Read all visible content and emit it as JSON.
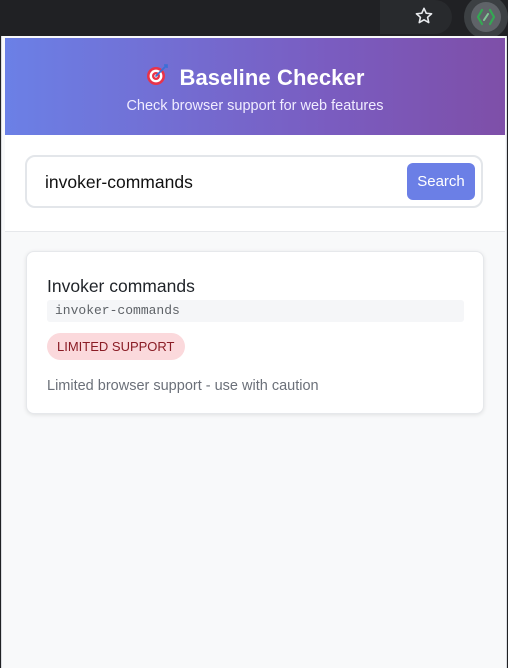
{
  "toolbar": {
    "star_icon": "star-outline-icon",
    "extension_icon": "baseline-extension-icon",
    "colors": {
      "extension_green": "#34a853"
    }
  },
  "header": {
    "icon": "dart-target-icon",
    "title": "Baseline Checker",
    "subtitle": "Check browser support for web features",
    "colors": {
      "gradient_start": "#6b80e6",
      "gradient_end": "#7e4fa8"
    }
  },
  "search": {
    "value": "invoker-commands",
    "button_label": "Search",
    "colors": {
      "button": "#6b7fe6"
    }
  },
  "result": {
    "name": "Invoker commands",
    "id": "invoker-commands",
    "badge": "LIMITED SUPPORT",
    "description": "Limited browser support - use with caution",
    "colors": {
      "badge_bg": "#fbd9dc",
      "badge_text": "#8a1c25"
    }
  }
}
